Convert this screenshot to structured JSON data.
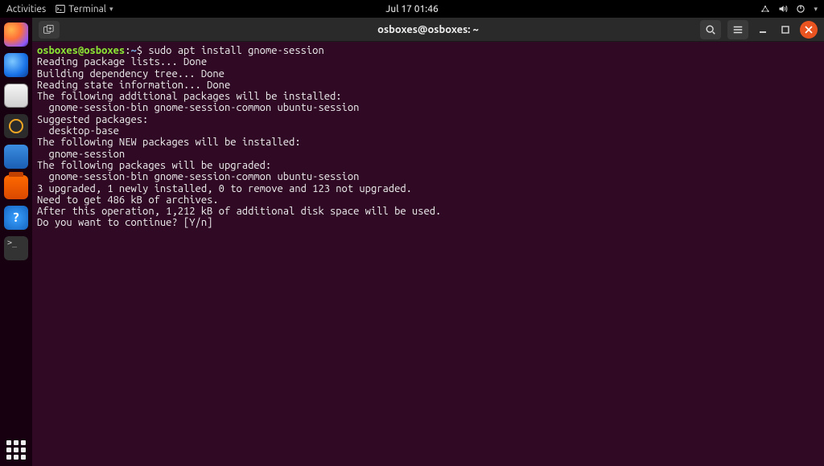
{
  "topbar": {
    "activities": "Activities",
    "app_name": "Terminal",
    "datetime": "Jul 17  01:46"
  },
  "dock": {
    "items": [
      {
        "name": "firefox",
        "label": "Firefox"
      },
      {
        "name": "thunderbird",
        "label": "Thunderbird"
      },
      {
        "name": "files",
        "label": "Files"
      },
      {
        "name": "rhythmbox",
        "label": "Rhythmbox"
      },
      {
        "name": "libreoffice-writer",
        "label": "LibreOffice Writer"
      },
      {
        "name": "ubuntu-software",
        "label": "Ubuntu Software"
      },
      {
        "name": "help",
        "label": "Help",
        "glyph": "?"
      },
      {
        "name": "terminal",
        "label": "Terminal",
        "glyph": ">_"
      }
    ],
    "show_apps": "Show Applications"
  },
  "window": {
    "title": "osboxes@osboxes: ~"
  },
  "terminal": {
    "prompt_userhost": "osboxes@osboxes",
    "prompt_sep": ":",
    "prompt_path": "~",
    "prompt_symbol": "$",
    "command": "sudo apt install gnome-session",
    "output": "Reading package lists... Done\nBuilding dependency tree... Done\nReading state information... Done\nThe following additional packages will be installed:\n  gnome-session-bin gnome-session-common ubuntu-session\nSuggested packages:\n  desktop-base\nThe following NEW packages will be installed:\n  gnome-session\nThe following packages will be upgraded:\n  gnome-session-bin gnome-session-common ubuntu-session\n3 upgraded, 1 newly installed, 0 to remove and 123 not upgraded.\nNeed to get 486 kB of archives.\nAfter this operation, 1,212 kB of additional disk space will be used.\nDo you want to continue? [Y/n] "
  }
}
